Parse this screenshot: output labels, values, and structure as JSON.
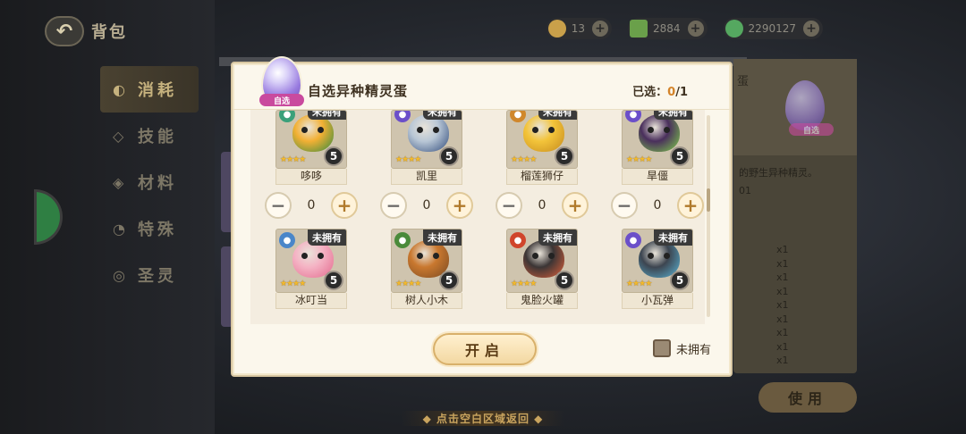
{
  "app": {
    "title": "背包"
  },
  "sidebar": {
    "items": [
      {
        "label": "消耗",
        "icon": "potion-icon",
        "active": true
      },
      {
        "label": "技能",
        "icon": "shield-icon",
        "active": false
      },
      {
        "label": "材料",
        "icon": "material-icon",
        "active": false
      },
      {
        "label": "特殊",
        "icon": "special-icon",
        "active": false
      },
      {
        "label": "圣灵",
        "icon": "spirit-icon",
        "active": false
      }
    ]
  },
  "currency": [
    {
      "value": "13",
      "icon": "coin-icon",
      "color": "#c9a04a"
    },
    {
      "value": "2884",
      "icon": "gem-icon",
      "color": "#6aa04a"
    },
    {
      "value": "2290127",
      "icon": "gold-icon",
      "color": "#55a860"
    }
  ],
  "background": {
    "detail_head": "蛋",
    "detail_text": "的野生异种精灵。",
    "detail_sub": "01",
    "detail_list": [
      "x1",
      "x1",
      "x1",
      "x1",
      "x1",
      "x1",
      "x1",
      "x1",
      "x1"
    ],
    "use_button": "使用",
    "egg_badge": "自选"
  },
  "dialog": {
    "title": "自选异种精灵蛋",
    "egg_badge": "自选",
    "selected_label": "已选：",
    "selected_value": "0",
    "selected_total": "/1",
    "open_button": "开启",
    "filter_label": "未拥有"
  },
  "pets_row1": [
    {
      "name": "哆哆",
      "badge": "未拥有",
      "level": "5",
      "stars": "★★★★",
      "element_color": "#3aa07a",
      "body_color": "#f2b034",
      "accent": "#2f8a3e"
    },
    {
      "name": "凯里",
      "badge": "未拥有",
      "level": "5",
      "stars": "★★★★",
      "element_color": "#6b4fc9",
      "body_color": "#b9c7d6",
      "accent": "#2f4a7a"
    },
    {
      "name": "榴莲狮仔",
      "badge": "未拥有",
      "level": "5",
      "stars": "★★★★",
      "element_color": "#d0872b",
      "body_color": "#f3c43a",
      "accent": "#c58a1e"
    },
    {
      "name": "旱僵",
      "badge": "未拥有",
      "level": "5",
      "stars": "★★★★",
      "element_color": "#6b4fc9",
      "body_color": "#4a2f5c",
      "accent": "#7fd14a"
    }
  ],
  "steppers": [
    {
      "value": "0"
    },
    {
      "value": "0"
    },
    {
      "value": "0"
    },
    {
      "value": "0"
    }
  ],
  "pets_row2": [
    {
      "name": "冰叮当",
      "badge": "未拥有",
      "level": "5",
      "stars": "★★★★",
      "element_color": "#4a86c9",
      "body_color": "#f4b3c4",
      "accent": "#e46a8e"
    },
    {
      "name": "树人小木",
      "badge": "未拥有",
      "level": "5",
      "stars": "★★★★",
      "element_color": "#4a8a3a",
      "body_color": "#c9782f",
      "accent": "#7a4a22"
    },
    {
      "name": "鬼脸火罐",
      "badge": "未拥有",
      "level": "5",
      "stars": "★★★★",
      "element_color": "#d0452b",
      "body_color": "#3b3535",
      "accent": "#e0613a"
    },
    {
      "name": "小瓦弹",
      "badge": "未拥有",
      "level": "5",
      "stars": "★★★★",
      "element_color": "#6b4fc9",
      "body_color": "#3d4550",
      "accent": "#5ab6d8"
    }
  ],
  "dismiss_hint": "◆ 点击空白区域返回 ◆"
}
